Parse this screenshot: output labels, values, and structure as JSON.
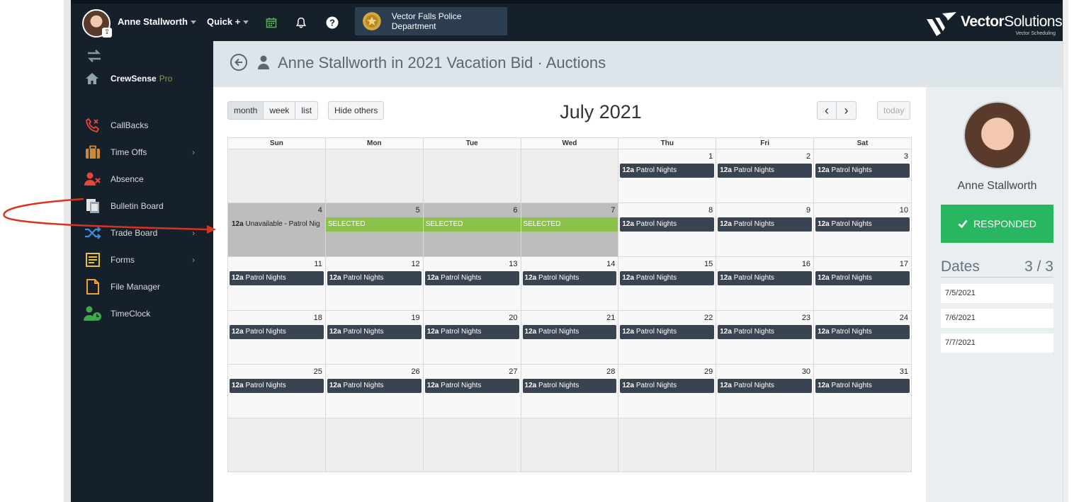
{
  "topbar": {
    "user_name": "Anne Stallworth",
    "quick_label": "Quick +",
    "department": "Vector Falls Police Department",
    "logo_bold": "Vector",
    "logo_light": "Solutions",
    "logo_sub": "Vector Scheduling"
  },
  "sidebar": {
    "brand_label": "CrewSense",
    "brand_pro": "Pro",
    "items": [
      {
        "label": "CallBacks",
        "icon": "phone-icon",
        "color": "#e8453c",
        "chevron": false
      },
      {
        "label": "Time Offs",
        "icon": "suitcase-icon",
        "color": "#c8893a",
        "chevron": true
      },
      {
        "label": "Absence",
        "icon": "user-x-icon",
        "color": "#e8453c",
        "chevron": false
      },
      {
        "label": "Bulletin Board",
        "icon": "clipboard-icon",
        "color": "#e6e6e6",
        "chevron": false
      },
      {
        "label": "Trade Board",
        "icon": "shuffle-icon",
        "color": "#3d8ee0",
        "chevron": true
      },
      {
        "label": "Forms",
        "icon": "form-icon",
        "color": "#e6c23a",
        "chevron": true
      },
      {
        "label": "File Manager",
        "icon": "file-icon",
        "color": "#f0a13a",
        "chevron": false
      },
      {
        "label": "TimeClock",
        "icon": "user-clock-icon",
        "color": "#3ea84a",
        "chevron": false
      }
    ]
  },
  "page": {
    "title": "Anne Stallworth in 2021 Vacation Bid · Auctions"
  },
  "calendar": {
    "view_buttons": [
      "month",
      "week",
      "list"
    ],
    "hide_others": "Hide others",
    "title": "July 2021",
    "prev": "‹",
    "next": "›",
    "today": "today",
    "weekdays": [
      "Sun",
      "Mon",
      "Tue",
      "Wed",
      "Thu",
      "Fri",
      "Sat"
    ],
    "event_time": "12a",
    "event_name": "Patrol Nights",
    "selected_label": "SELECTED",
    "unavailable_label": "Unavailable - Patrol Nig",
    "weeks": [
      [
        null,
        null,
        null,
        null,
        1,
        2,
        3
      ],
      [
        4,
        5,
        6,
        7,
        8,
        9,
        10
      ],
      [
        11,
        12,
        13,
        14,
        15,
        16,
        17
      ],
      [
        18,
        19,
        20,
        21,
        22,
        23,
        24
      ],
      [
        25,
        26,
        27,
        28,
        29,
        30,
        31
      ],
      [
        null,
        null,
        null,
        null,
        null,
        null,
        null
      ]
    ]
  },
  "panel": {
    "name": "Anne Stallworth",
    "responded": "RESPONDED",
    "dates_label": "Dates",
    "dates_count": "3 / 3",
    "dates": [
      "7/5/2021",
      "7/6/2021",
      "7/7/2021"
    ]
  }
}
